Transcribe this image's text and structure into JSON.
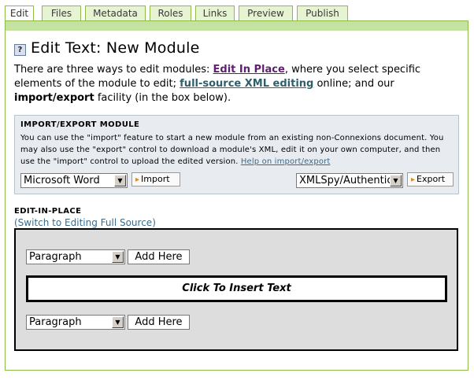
{
  "tabs": [
    "Edit",
    "Files",
    "Metadata",
    "Roles",
    "Links",
    "Preview",
    "Publish"
  ],
  "title": "Edit Text: New Module",
  "help_icon": "?",
  "intro": {
    "part1": "There are three ways to edit modules: ",
    "edit_in_place_link": "Edit In Place",
    "part2": ", where you select specific elements of the module to edit; ",
    "full_source_link": "full-source XML editing",
    "part3": " online; and our ",
    "import_export_bold": "import/export",
    "part4": " facility (in the box below)."
  },
  "import_export": {
    "heading": "IMPORT/EXPORT MODULE",
    "description": "You can use the \"import\" feature to start a new module from an existing non-Connexions document. You may also use the \"export\" control to download a module's XML, edit it on your own computer, and then use the \"import\" control to upload the edited version. ",
    "help_link": "Help on import/export",
    "import_format": "Microsoft Word",
    "import_button": "Import",
    "export_format": "XMLSpy/Authentic",
    "export_button": "Export"
  },
  "edit_in_place": {
    "heading": "EDIT-IN-PLACE",
    "switch_link": "(Switch to Editing Full Source)",
    "top_select": "Paragraph",
    "top_add": "Add Here",
    "insert_text": "Click To Insert Text",
    "bottom_select": "Paragraph",
    "bottom_add": "Add Here"
  }
}
